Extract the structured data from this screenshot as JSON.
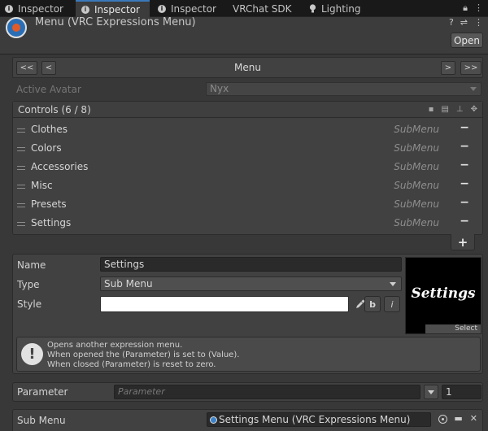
{
  "tabs": [
    {
      "label": "Inspector",
      "icon": "info-icon"
    },
    {
      "label": "Inspector",
      "icon": "info-icon",
      "active": true
    },
    {
      "label": "Inspector",
      "icon": "info-icon"
    },
    {
      "label": "VRChat SDK",
      "icon": ""
    },
    {
      "label": "Lighting",
      "icon": "lightbulb-icon"
    }
  ],
  "header": {
    "title": "Menu (VRC Expressions Menu)",
    "open_label": "Open"
  },
  "nav": {
    "first": "<<",
    "prev": "<",
    "title": "Menu",
    "next": ">",
    "last": ">>"
  },
  "avatar": {
    "label": "Active Avatar",
    "value": "Nyx"
  },
  "controls": {
    "title": "Controls (6 / 8)",
    "items": [
      {
        "label": "Clothes",
        "type": "SubMenu"
      },
      {
        "label": "Colors",
        "type": "SubMenu"
      },
      {
        "label": "Accessories",
        "type": "SubMenu"
      },
      {
        "label": "Misc",
        "type": "SubMenu"
      },
      {
        "label": "Presets",
        "type": "SubMenu"
      },
      {
        "label": "Settings",
        "type": "SubMenu"
      }
    ],
    "remove_glyph": "−",
    "add_glyph": "+"
  },
  "detail": {
    "name_label": "Name",
    "name_value": "Settings",
    "type_label": "Type",
    "type_value": "Sub Menu",
    "style_label": "Style",
    "style_bold": "b",
    "style_italic": "i",
    "preview_text": "Settings",
    "select_label": "Select",
    "help_lines": [
      "Opens another expression menu.",
      "When opened the (Parameter) is set to (Value).",
      "When closed (Parameter) is reset to zero."
    ]
  },
  "parameter": {
    "label": "Parameter",
    "placeholder": "Parameter",
    "value": "1"
  },
  "submenu": {
    "label": "Sub Menu",
    "value": "Settings Menu (VRC Expressions Menu)"
  },
  "colors": {
    "accent": "#3a79bb",
    "background": "#383838",
    "panel": "#414141"
  }
}
